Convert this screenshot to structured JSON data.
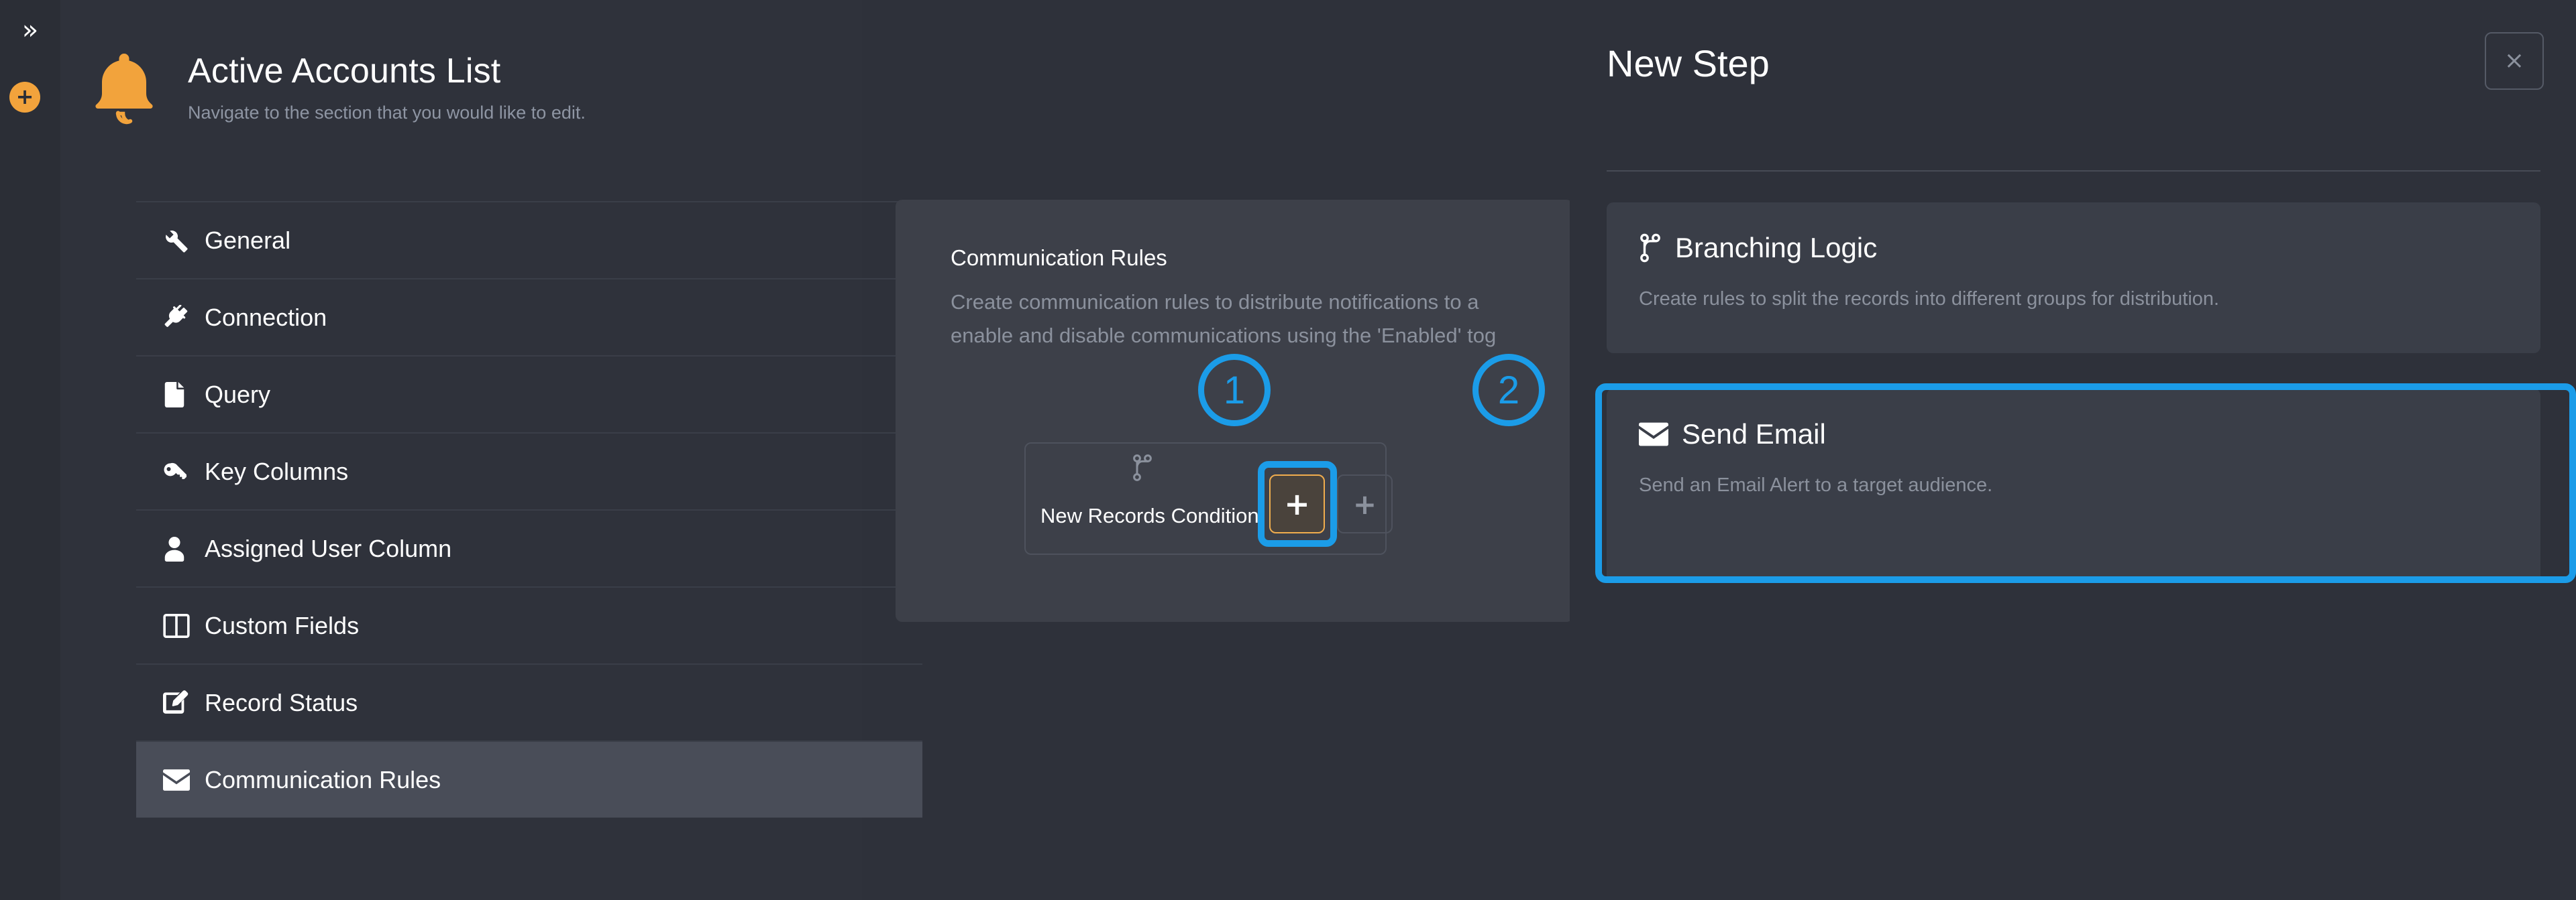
{
  "rail": {
    "expand_icon": "chevron-double-right-icon",
    "add_icon": "plus-circle-icon"
  },
  "section": {
    "icon": "bell-icon",
    "title": "Active Accounts List",
    "subtitle": "Navigate to the section that you would like to edit.",
    "nav_items": [
      {
        "label": "General",
        "icon": "wrench-icon",
        "active": false
      },
      {
        "label": "Connection",
        "icon": "plug-icon",
        "active": false
      },
      {
        "label": "Query",
        "icon": "file-icon",
        "active": false
      },
      {
        "label": "Key Columns",
        "icon": "key-icon",
        "active": false
      },
      {
        "label": "Assigned User Column",
        "icon": "user-icon",
        "active": false
      },
      {
        "label": "Custom Fields",
        "icon": "columns-icon",
        "active": false
      },
      {
        "label": "Record Status",
        "icon": "edit-square-icon",
        "active": false
      },
      {
        "label": "Communication Rules",
        "icon": "envelope-icon",
        "active": true
      }
    ]
  },
  "content": {
    "title": "Communication Rules",
    "description_line1": "Create communication rules to distribute notifications to a",
    "description_line2": "enable and disable communications using the 'Enabled' tog",
    "flow_node_label": "New Records Condition",
    "flow_node_icon": "branch-icon",
    "add_step_button": "+",
    "add_step_button_secondary": "+"
  },
  "drawer": {
    "title": "New Step",
    "close_label": "×",
    "steps": [
      {
        "title": "Branching Logic",
        "icon": "branch-icon",
        "description": "Create rules to split the records into different groups for distribution.",
        "highlighted": false
      },
      {
        "title": "Send Email",
        "icon": "envelope-icon",
        "description": "Send an Email Alert to a target audience.",
        "highlighted": true
      }
    ]
  },
  "annotations": {
    "marker_1": "1",
    "marker_2": "2",
    "color": "#1b9ce8"
  },
  "colors": {
    "page_background": "#2e313a",
    "panel_background": "#2f323b",
    "card_background": "#3d4049",
    "step_card_background": "#3a3e48",
    "accent_orange": "#f0ad4e",
    "bell_orange": "#f2a33c",
    "annotation_blue": "#1b9ce8",
    "muted_text": "#8b919d",
    "active_nav_background": "#494d58"
  }
}
